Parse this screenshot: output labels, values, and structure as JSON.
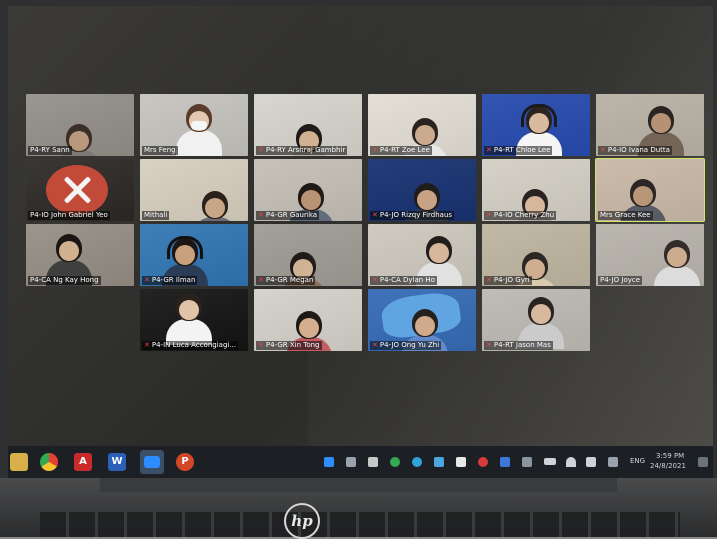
{
  "meeting": {
    "participants": [
      {
        "name": "P4-RY Sann",
        "muted": false
      },
      {
        "name": "Mrs Feng",
        "muted": false
      },
      {
        "name": "P4-RY Arshraj Gambhir",
        "muted": true
      },
      {
        "name": "P4-RT Zoe Lee",
        "muted": true
      },
      {
        "name": "P4-RT Chloe Lee",
        "muted": true
      },
      {
        "name": "P4-IO Ivana Dutta",
        "muted": true
      },
      {
        "name": "P4-IO John Gabriel Yeo",
        "muted": false
      },
      {
        "name": "Mithali",
        "muted": false
      },
      {
        "name": "P4-GR Gaurika",
        "muted": true
      },
      {
        "name": "P4-JO Rizqy Firdhaus",
        "muted": true
      },
      {
        "name": "P4-IO Cherry Zhu",
        "muted": true
      },
      {
        "name": "Mrs Grace Kee",
        "muted": false
      },
      {
        "name": "P4-CA Ng Kay Hong",
        "muted": false
      },
      {
        "name": "P4-GR Ilman",
        "muted": true
      },
      {
        "name": "P4-GR Megan",
        "muted": true
      },
      {
        "name": "P4-CA Dylan Ho",
        "muted": true
      },
      {
        "name": "P4-JO Gyri",
        "muted": true
      },
      {
        "name": "P4-JO Joyce",
        "muted": false
      },
      {
        "name": "P4-IN Luca Accongiagi...",
        "muted": true
      },
      {
        "name": "P4-GR Xin Tong",
        "muted": true
      },
      {
        "name": "P4-JO Ong Yu Zhi",
        "muted": true
      },
      {
        "name": "P4-RT Jason Mas",
        "muted": true
      }
    ]
  },
  "taskbar": {
    "apps": [
      "file-explorer-icon",
      "chrome-icon",
      "acrobat-icon",
      "word-icon",
      "zoom-icon",
      "powerpoint-icon"
    ],
    "language": "ENG",
    "time": "3:59 PM",
    "date": "24/8/2021"
  },
  "laptop": {
    "logo_text": "hp"
  }
}
